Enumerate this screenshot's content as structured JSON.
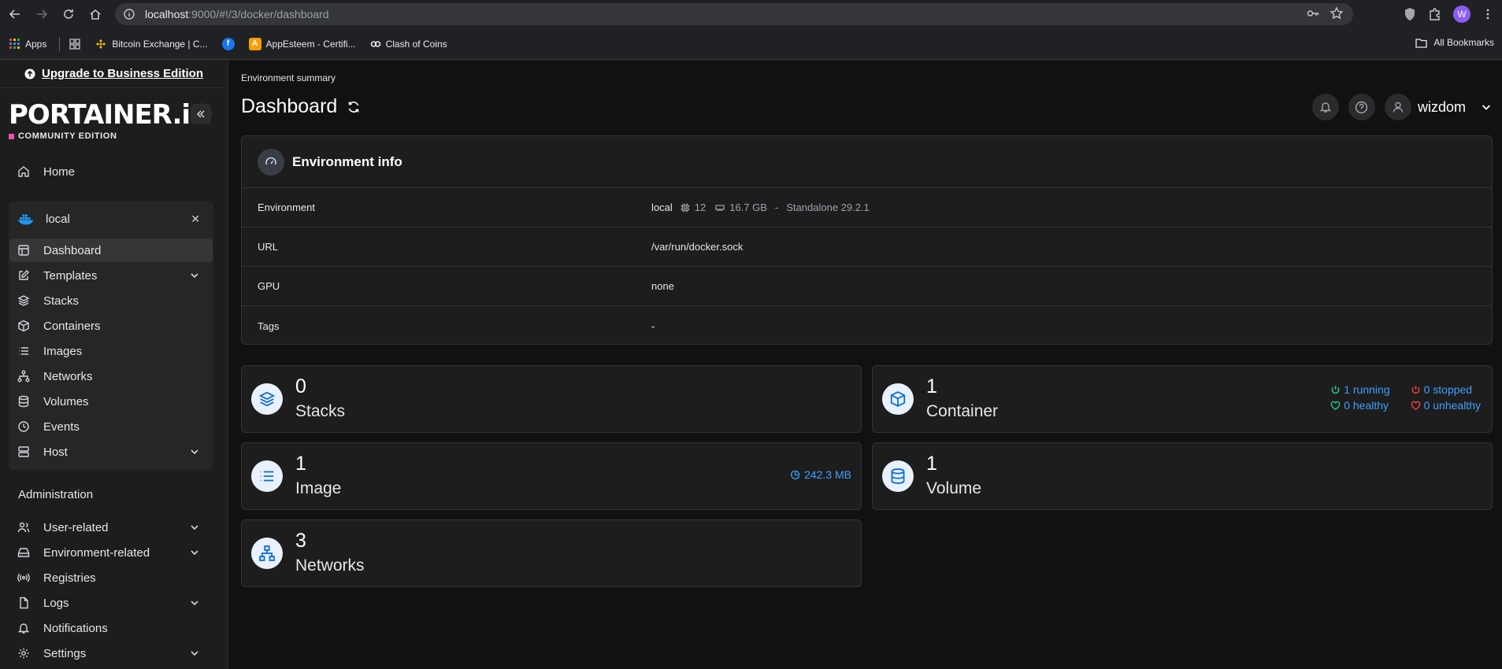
{
  "browser": {
    "url_host": "localhost",
    "url_path": ":9000/#!/3/docker/dashboard",
    "avatar_letter": "W",
    "bookmarks": [
      {
        "label": "Apps"
      },
      {
        "label": "Bitcoin Exchange | C..."
      },
      {
        "label": ""
      },
      {
        "label": "AppEsteem - Certifi..."
      },
      {
        "label": "Clash of Coins"
      }
    ],
    "all_bookmarks": "All Bookmarks"
  },
  "sidebar": {
    "upgrade_label": "Upgrade to Business Edition",
    "logo_text": "PORTAINER.iO",
    "edition": "COMMUNITY EDITION",
    "home": "Home",
    "environment_name": "local",
    "env_items": [
      {
        "label": "Dashboard",
        "icon": "dashboard-icon"
      },
      {
        "label": "Templates",
        "icon": "edit-icon"
      },
      {
        "label": "Stacks",
        "icon": "layers-icon"
      },
      {
        "label": "Containers",
        "icon": "box-icon"
      },
      {
        "label": "Images",
        "icon": "list-icon"
      },
      {
        "label": "Networks",
        "icon": "network-icon"
      },
      {
        "label": "Volumes",
        "icon": "database-icon"
      },
      {
        "label": "Events",
        "icon": "clock-icon"
      },
      {
        "label": "Host",
        "icon": "server-icon"
      }
    ],
    "admin_title": "Administration",
    "admin_items": [
      {
        "label": "User-related",
        "icon": "users-icon"
      },
      {
        "label": "Environment-related",
        "icon": "hdd-icon"
      },
      {
        "label": "Registries",
        "icon": "radio-icon"
      },
      {
        "label": "Logs",
        "icon": "file-icon"
      },
      {
        "label": "Notifications",
        "icon": "bell-icon"
      },
      {
        "label": "Settings",
        "icon": "gear-icon"
      }
    ]
  },
  "header": {
    "breadcrumb": "Environment summary",
    "title": "Dashboard",
    "username": "wizdom"
  },
  "env_info": {
    "title": "Environment info",
    "rows": {
      "environment": {
        "key": "Environment",
        "name": "local",
        "cpu": "12",
        "memory": "16.7 GB",
        "sep": "-",
        "type": "Standalone 29.2.1"
      },
      "url": {
        "key": "URL",
        "value": "/var/run/docker.sock"
      },
      "gpu": {
        "key": "GPU",
        "value": "none"
      },
      "tags": {
        "key": "Tags",
        "value": "-"
      }
    }
  },
  "stats": {
    "stacks": {
      "count": "0",
      "label": "Stacks"
    },
    "containers": {
      "count": "1",
      "label": "Container",
      "running": "1 running",
      "stopped": "0 stopped",
      "healthy": "0 healthy",
      "unhealthy": "0 unhealthy"
    },
    "images": {
      "count": "1",
      "label": "Image",
      "size": "242.3 MB"
    },
    "volumes": {
      "count": "1",
      "label": "Volume"
    },
    "networks": {
      "count": "3",
      "label": "Networks"
    }
  }
}
